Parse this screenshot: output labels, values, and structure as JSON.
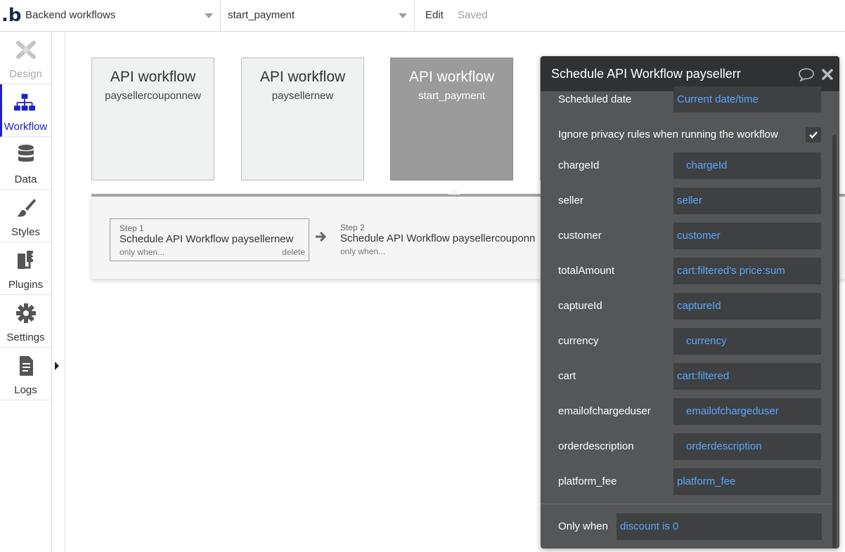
{
  "topbar": {
    "logo": ".b",
    "page_select": "Backend workflows",
    "workflow_select": "start_payment",
    "edit_label": "Edit",
    "saved_label": "Saved"
  },
  "sidebar": {
    "items": [
      {
        "label": "Design",
        "icon": "design-icon",
        "state": "disabled"
      },
      {
        "label": "Workflow",
        "icon": "workflow-icon",
        "state": "active"
      },
      {
        "label": "Data",
        "icon": "database-icon",
        "state": "normal"
      },
      {
        "label": "Styles",
        "icon": "brush-icon",
        "state": "normal"
      },
      {
        "label": "Plugins",
        "icon": "plug-icon",
        "state": "normal"
      },
      {
        "label": "Settings",
        "icon": "gear-icon",
        "state": "normal"
      },
      {
        "label": "Logs",
        "icon": "document-icon",
        "state": "normal"
      }
    ]
  },
  "canvas": {
    "cards": [
      {
        "title": "API workflow",
        "name": "paysellercouponnew"
      },
      {
        "title": "API workflow",
        "name": "paysellernew"
      },
      {
        "title": "API workflow",
        "name": "start_payment",
        "selected": true
      }
    ],
    "steps": [
      {
        "step": "Step 1",
        "title": "Schedule API Workflow paysellernew",
        "only_when": "only when...",
        "delete": "delete"
      },
      {
        "step": "Step 2",
        "title": "Schedule API Workflow paysellercouponn",
        "only_when": "only when..."
      }
    ]
  },
  "props": {
    "title": "Schedule API Workflow paysellerr",
    "scheduled_date": {
      "label": "Scheduled date",
      "value": "Current date/time"
    },
    "privacy": {
      "label": "Ignore privacy rules when running the workflow",
      "checked": true
    },
    "params": [
      {
        "label": "chargeId",
        "value": "chargeId"
      },
      {
        "label": "seller",
        "value": "seller"
      },
      {
        "label": "customer",
        "value": "customer"
      },
      {
        "label": "totalAmount",
        "value": "cart:filtered's price:sum"
      },
      {
        "label": "captureId",
        "value": "captureId"
      },
      {
        "label": "currency",
        "value": "currency"
      },
      {
        "label": "cart",
        "value": "cart:filtered"
      },
      {
        "label": "emailofchargeduser",
        "value": "emailofchargeduser"
      },
      {
        "label": "orderdescription",
        "value": "orderdescription"
      },
      {
        "label": "platform_fee",
        "value": "platform_fee"
      }
    ],
    "only_when": {
      "label": "Only when",
      "value": "discount is 0"
    }
  },
  "colors": {
    "accent": "#1f1fc9",
    "link": "#57a8ff",
    "panel_bg": "#555657",
    "panel_header": "#2f3133"
  }
}
